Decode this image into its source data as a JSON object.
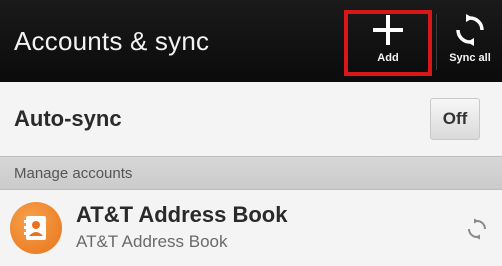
{
  "appbar": {
    "title": "Accounts & sync",
    "add_label": "Add",
    "sync_all_label": "Sync all"
  },
  "autosync": {
    "label": "Auto-sync",
    "toggle_value": "Off"
  },
  "section": {
    "label": "Manage accounts"
  },
  "accounts": [
    {
      "title": "AT&T Address Book",
      "subtitle": "AT&T Address Book",
      "icon": "address-book-icon"
    }
  ],
  "colors": {
    "appbar_bg": "#0f0f0f",
    "highlight": "#d81818",
    "avatar": "#e8731c"
  }
}
